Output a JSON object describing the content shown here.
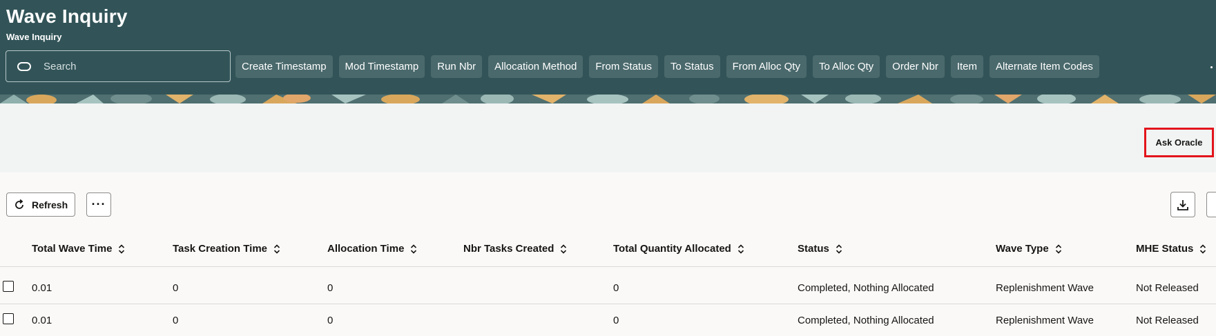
{
  "header": {
    "title": "Wave Inquiry",
    "subtitle": "Wave Inquiry",
    "search_placeholder": "Search",
    "filter_chips": [
      "Create Timestamp",
      "Mod Timestamp",
      "Run Nbr",
      "Allocation Method",
      "From Status",
      "To Status",
      "From Alloc Qty",
      "To Alloc Qty",
      "Order Nbr",
      "Item",
      "Alternate Item Codes"
    ]
  },
  "ask_oracle": {
    "label": "Ask Oracle",
    "highlight_color": "#e3141b"
  },
  "toolbar": {
    "refresh_label": "Refresh",
    "more_label": "···"
  },
  "table": {
    "columns": [
      "Total Wave Time",
      "Task Creation Time",
      "Allocation Time",
      "Nbr Tasks Created",
      "Total Quantity Allocated",
      "Status",
      "Wave Type",
      "MHE Status"
    ],
    "rows": [
      [
        "0.01",
        "0",
        "0",
        "",
        "0",
        "Completed, Nothing Allocated",
        "Replenishment Wave",
        "Not Released"
      ],
      [
        "0.01",
        "0",
        "0",
        "",
        "0",
        "Completed, Nothing Allocated",
        "Replenishment Wave",
        "Not Released"
      ]
    ]
  },
  "colors": {
    "header_bg": "#325458",
    "chip_bg": "#4a696c",
    "band_bg": "#f1f4f3",
    "page_bg": "#fbf9f8"
  },
  "icons": [
    "search-icon",
    "refresh-icon",
    "more-icon",
    "download-icon",
    "sort-icon"
  ]
}
